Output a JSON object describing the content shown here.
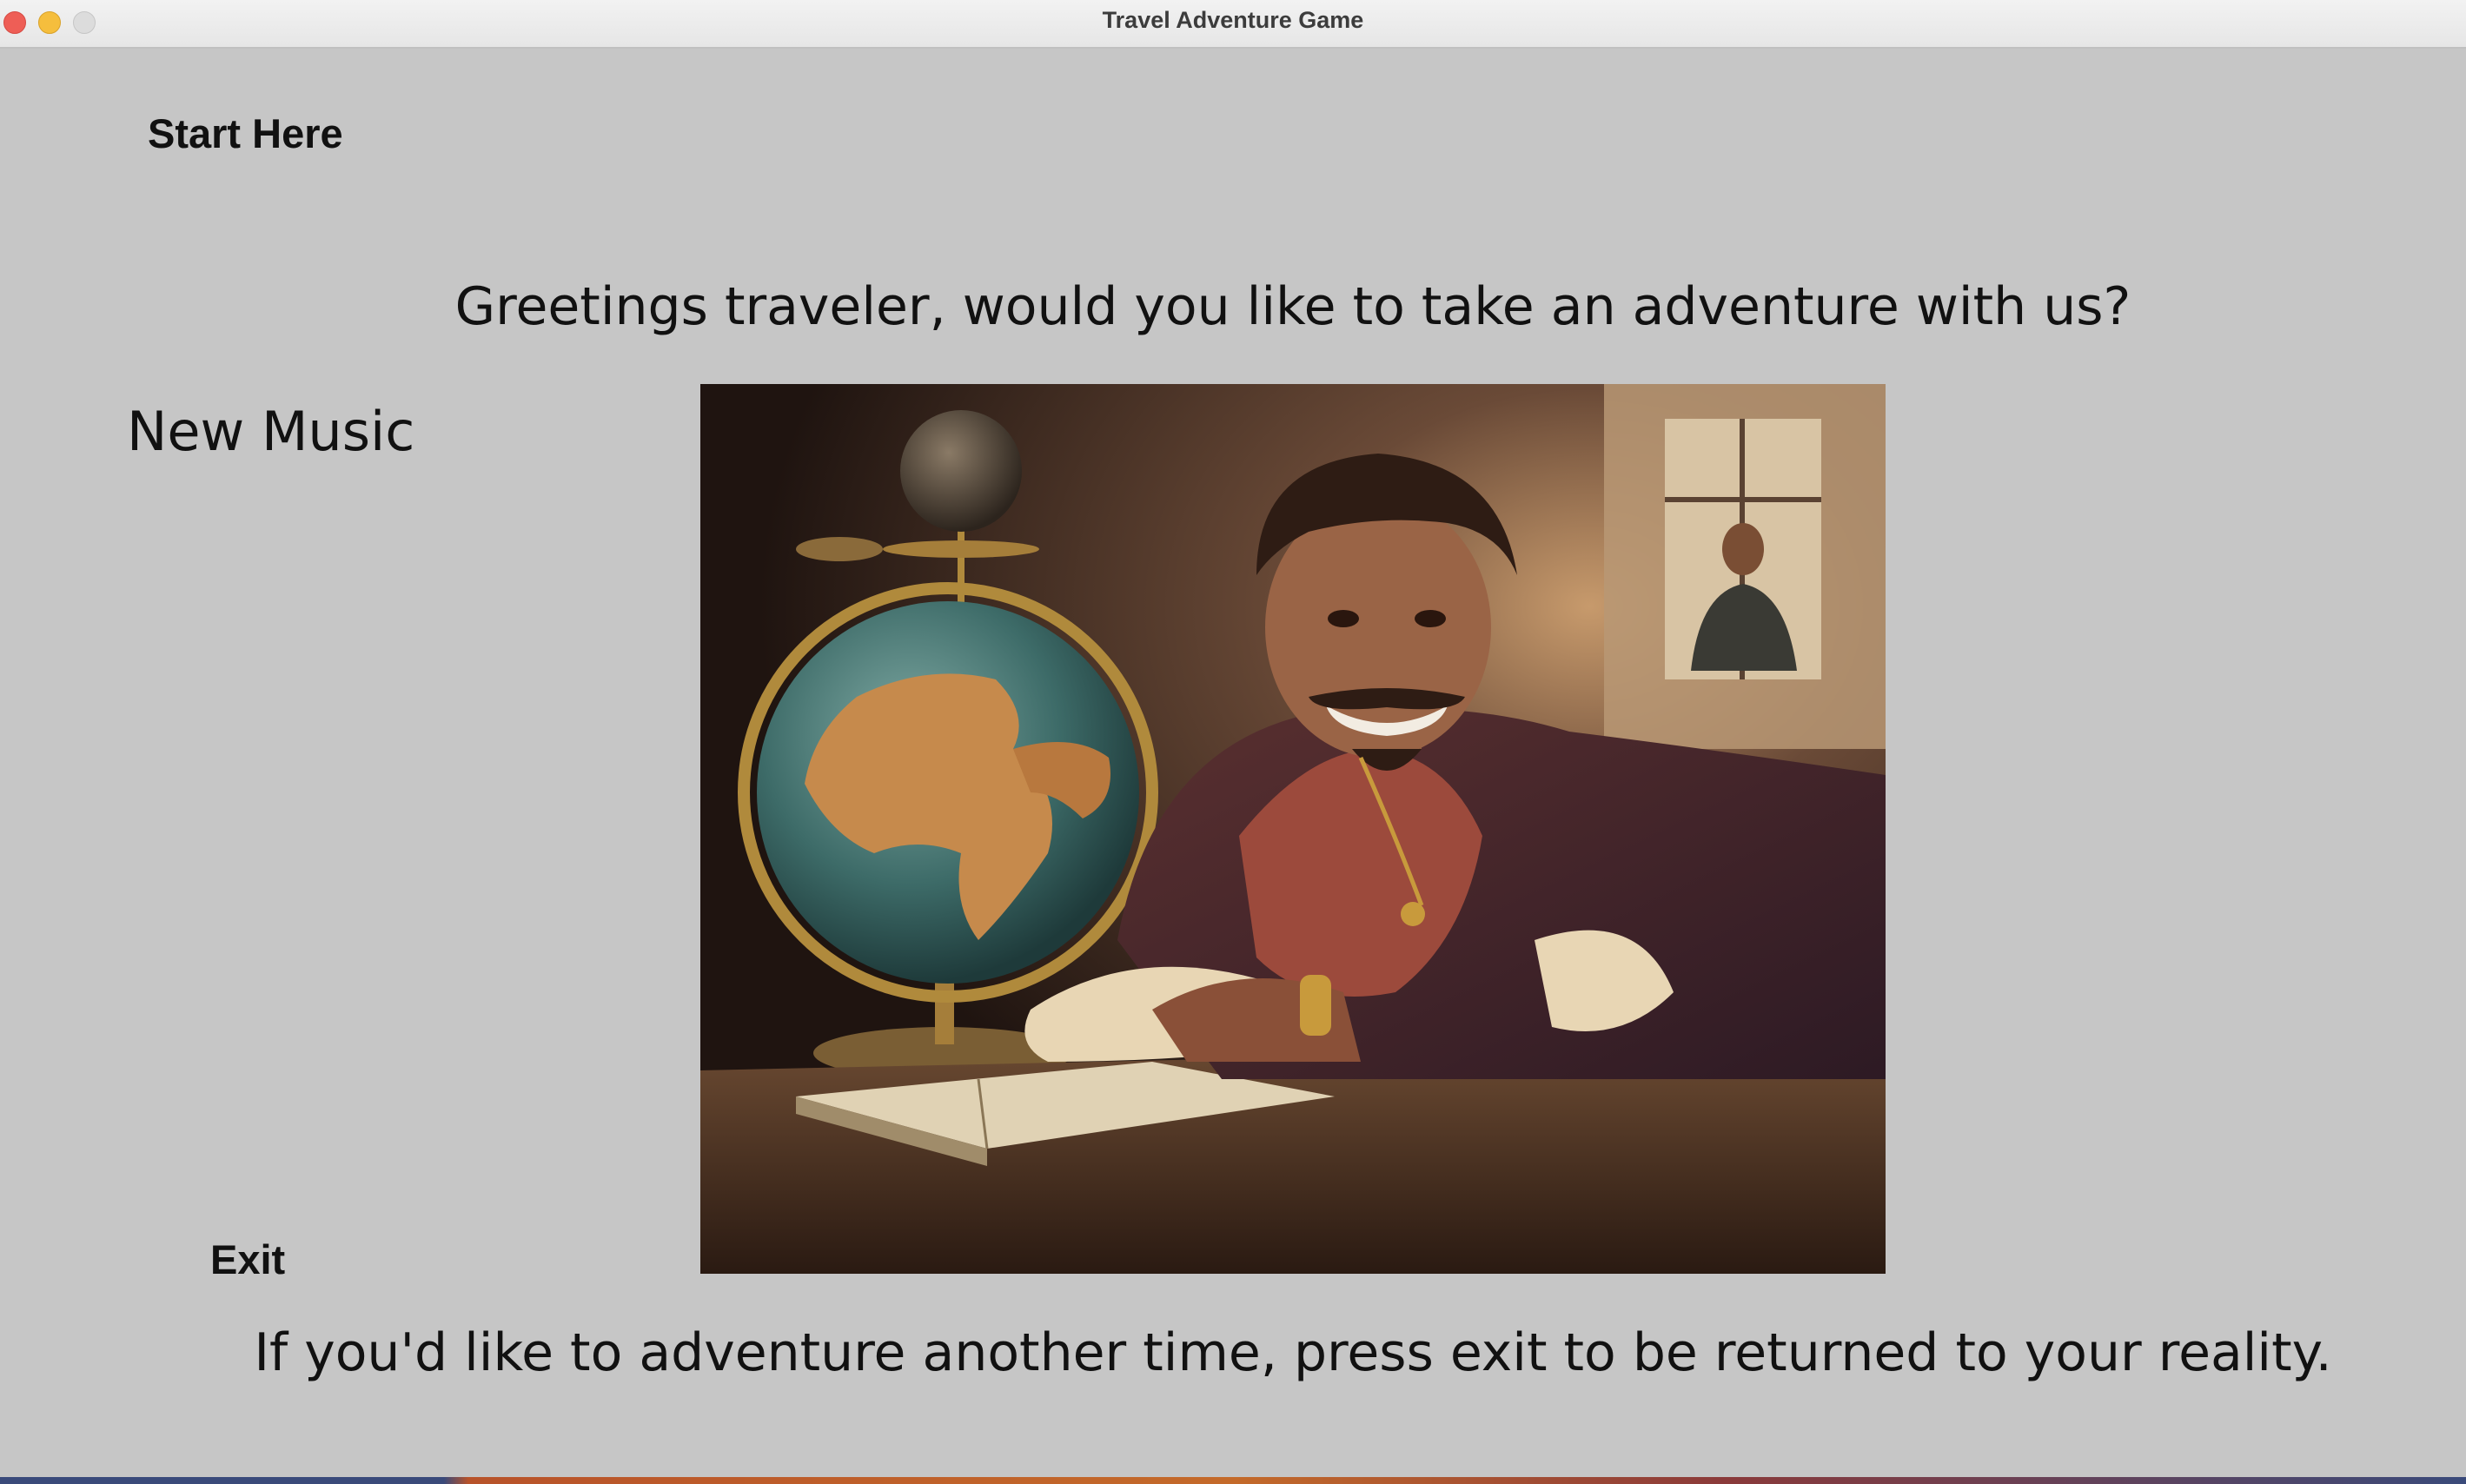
{
  "window": {
    "title": "Travel Adventure Game"
  },
  "buttons": {
    "start_label": "Start Here",
    "exit_label": "Exit",
    "new_music_label": "New Music"
  },
  "text": {
    "greeting": "Greetings traveler, would you like to take an adventure with us?",
    "farewell": "If you'd like to adventure another time, press exit to be returned to your reality."
  },
  "image": {
    "subject": "smiling-traveler-with-globe-illustration"
  },
  "colors": {
    "background": "#c6c6c6",
    "text": "#111111"
  }
}
